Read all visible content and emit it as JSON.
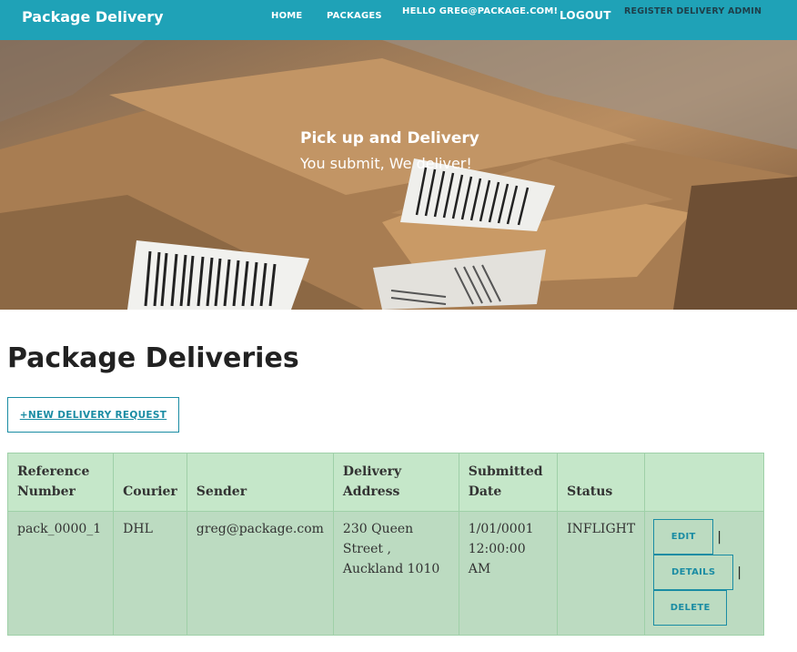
{
  "navbar": {
    "brand": "Package Delivery",
    "home": "HOME",
    "packages": "PACKAGES",
    "hello": "HELLO GREG@PACKAGE.COM!",
    "logout": "LOGOUT",
    "register": "REGISTER DELIVERY ADMIN",
    "bg_color": "#1fa2b7"
  },
  "hero": {
    "title": "Pick up and Delivery",
    "subtitle": "You submit, We deliver!"
  },
  "main": {
    "title": "Package Deliveries",
    "new_button": "+NEW DELIVERY REQUEST"
  },
  "table": {
    "headers": {
      "reference": "Reference Number",
      "courier": "Courier",
      "sender": "Sender",
      "address": "Delivery Address",
      "submitted": "Submitted Date",
      "status": "Status"
    },
    "rows": [
      {
        "reference": "pack_0000_1",
        "courier": "DHL",
        "sender": "greg@package.com",
        "address": "230 Queen Street , Auckland 1010",
        "submitted": "1/01/0001 12:00:00 AM",
        "status": "INFLIGHT",
        "edit": "EDIT",
        "details": "DETAILS",
        "delete": "DELETE",
        "separator": "|"
      }
    ]
  },
  "colors": {
    "accent": "#1a8ca3",
    "header_row": "#c5e7c9",
    "body_row": "#bcdbc1"
  }
}
